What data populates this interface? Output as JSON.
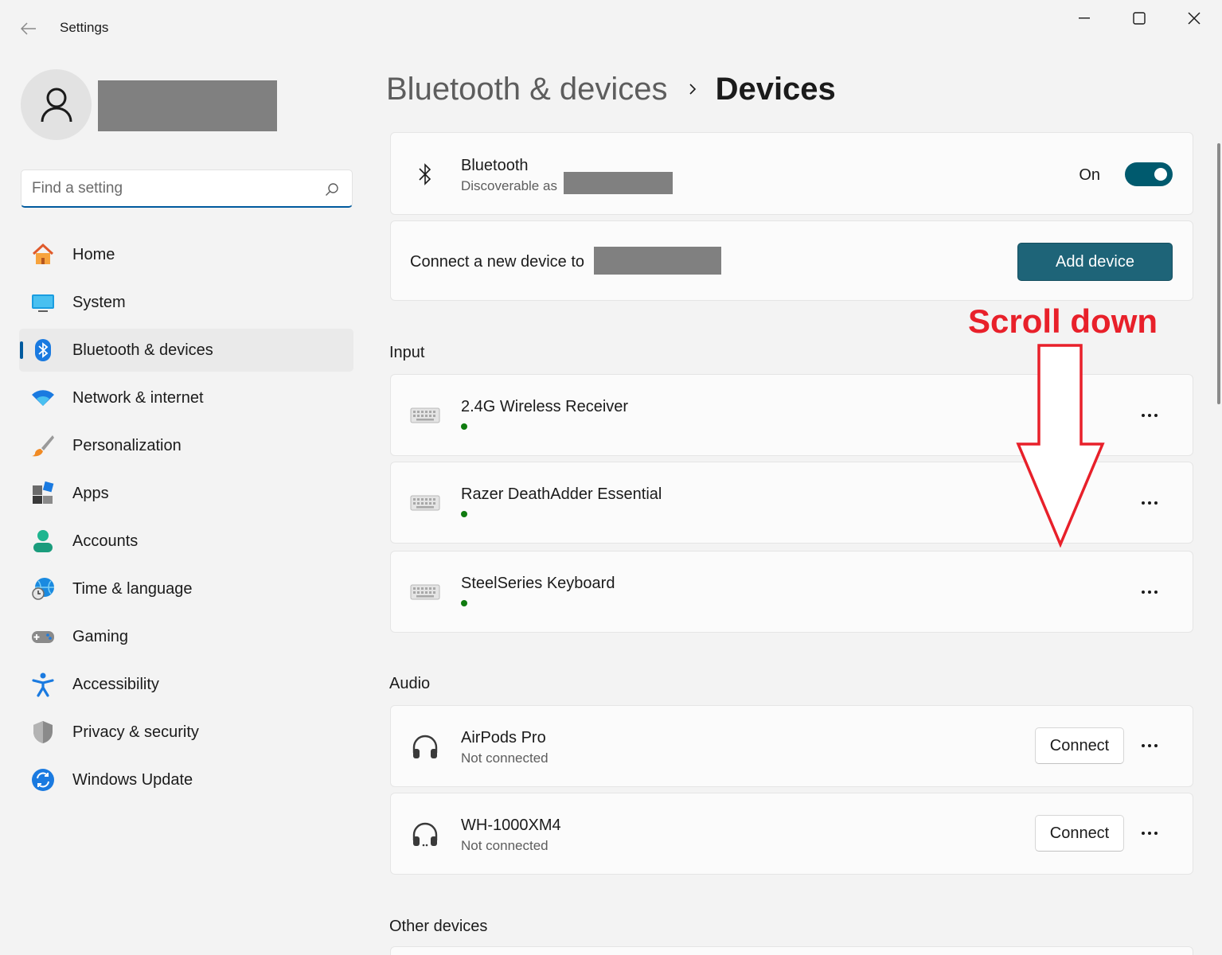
{
  "window": {
    "app_title": "Settings"
  },
  "search": {
    "placeholder": "Find a setting"
  },
  "sidebar": {
    "items": [
      {
        "label": "Home",
        "icon": "home-icon"
      },
      {
        "label": "System",
        "icon": "system-icon"
      },
      {
        "label": "Bluetooth & devices",
        "icon": "bluetooth-icon",
        "active": true
      },
      {
        "label": "Network & internet",
        "icon": "wifi-icon"
      },
      {
        "label": "Personalization",
        "icon": "brush-icon"
      },
      {
        "label": "Apps",
        "icon": "apps-icon"
      },
      {
        "label": "Accounts",
        "icon": "accounts-icon"
      },
      {
        "label": "Time & language",
        "icon": "time-language-icon"
      },
      {
        "label": "Gaming",
        "icon": "gamepad-icon"
      },
      {
        "label": "Accessibility",
        "icon": "accessibility-icon"
      },
      {
        "label": "Privacy & security",
        "icon": "shield-icon"
      },
      {
        "label": "Windows Update",
        "icon": "update-icon"
      }
    ]
  },
  "breadcrumb": {
    "parent": "Bluetooth & devices",
    "current": "Devices"
  },
  "bluetooth": {
    "title": "Bluetooth",
    "subtitle": "Discoverable as",
    "toggle_label": "On",
    "toggle_on": true
  },
  "connect_card": {
    "text": "Connect a new device to",
    "button": "Add device"
  },
  "sections": {
    "input": "Input",
    "audio": "Audio",
    "other": "Other devices"
  },
  "input_devices": [
    {
      "name": "2.4G Wireless Receiver",
      "icon": "keyboard-icon",
      "connected": true
    },
    {
      "name": "Razer DeathAdder Essential",
      "icon": "keyboard-icon",
      "connected": true
    },
    {
      "name": "SteelSeries Keyboard",
      "icon": "keyboard-icon",
      "connected": true
    }
  ],
  "audio_devices": [
    {
      "name": "AirPods Pro",
      "status": "Not connected",
      "button": "Connect",
      "icon": "headphones-icon"
    },
    {
      "name": "WH-1000XM4",
      "status": "Not connected",
      "button": "Connect",
      "icon": "headphones-icon"
    }
  ],
  "annotation": {
    "text": "Scroll down",
    "color": "#e8202a"
  },
  "colors": {
    "accent": "#005a9e",
    "toggle": "#005a6e",
    "add_button": "#1e6478",
    "connected_dot": "#0f7b0f"
  }
}
